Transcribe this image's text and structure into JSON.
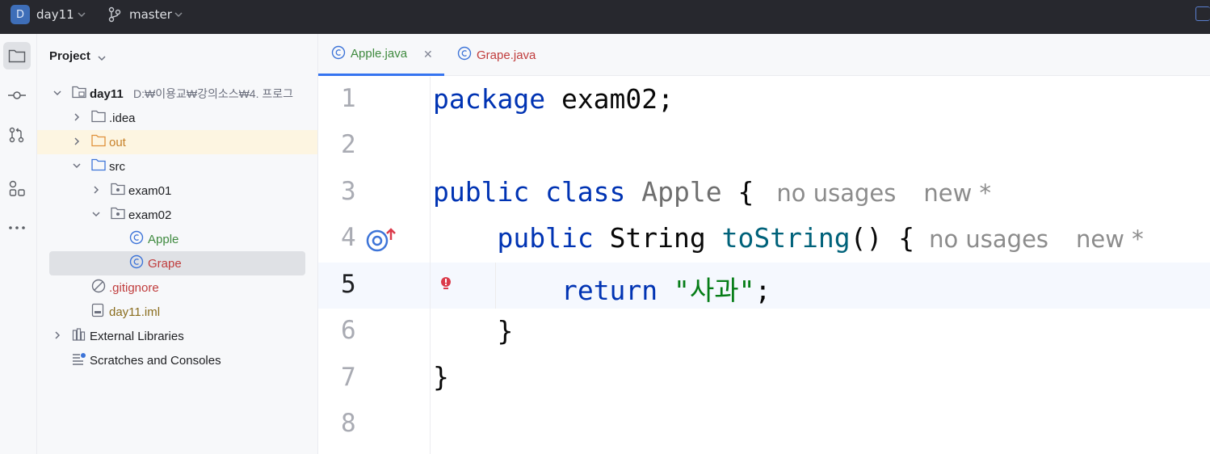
{
  "titlebar": {
    "project_initial": "D",
    "project_name": "day11",
    "branch": "master"
  },
  "project_panel": {
    "title": "Project",
    "tree": [
      {
        "label": "day11",
        "path": "D:₩이용교₩강의소스₩4. 프로그"
      },
      {
        "label": ".idea"
      },
      {
        "label": "out"
      },
      {
        "label": "src"
      },
      {
        "label": "exam01"
      },
      {
        "label": "exam02"
      },
      {
        "label": "Apple"
      },
      {
        "label": "Grape"
      },
      {
        "label": ".gitignore"
      },
      {
        "label": "day11.iml"
      },
      {
        "label": "External Libraries"
      },
      {
        "label": "Scratches and Consoles"
      }
    ]
  },
  "editor": {
    "tabs": [
      {
        "label": "Apple.java",
        "active": true
      },
      {
        "label": "Grape.java",
        "active": false
      }
    ],
    "line_numbers": [
      "1",
      "2",
      "3",
      "4",
      "5",
      "6",
      "7",
      "8"
    ],
    "current_line": 5,
    "code": {
      "l1_kw": "package",
      "l1_rest": " exam02;",
      "l3_kw": "public class",
      "l3_cls": " Apple",
      "l3_brace": " {",
      "l3_hint1": "no usages",
      "l3_hint2": "new *",
      "l4_kw": "public",
      "l4_type": " String",
      "l4_fn": " toString",
      "l4_rest": "() {",
      "l4_hint1": "no usages",
      "l4_hint2": "new *",
      "l5_kw": "return",
      "l5_str": " \"사과\"",
      "l5_rest": ";",
      "l6": "}",
      "l7": "}"
    }
  },
  "colors": {
    "keyword": "#0033b3",
    "string": "#067d17",
    "function": "#00627a",
    "accent": "#3574f0",
    "titlebar_bg": "#27282e"
  }
}
